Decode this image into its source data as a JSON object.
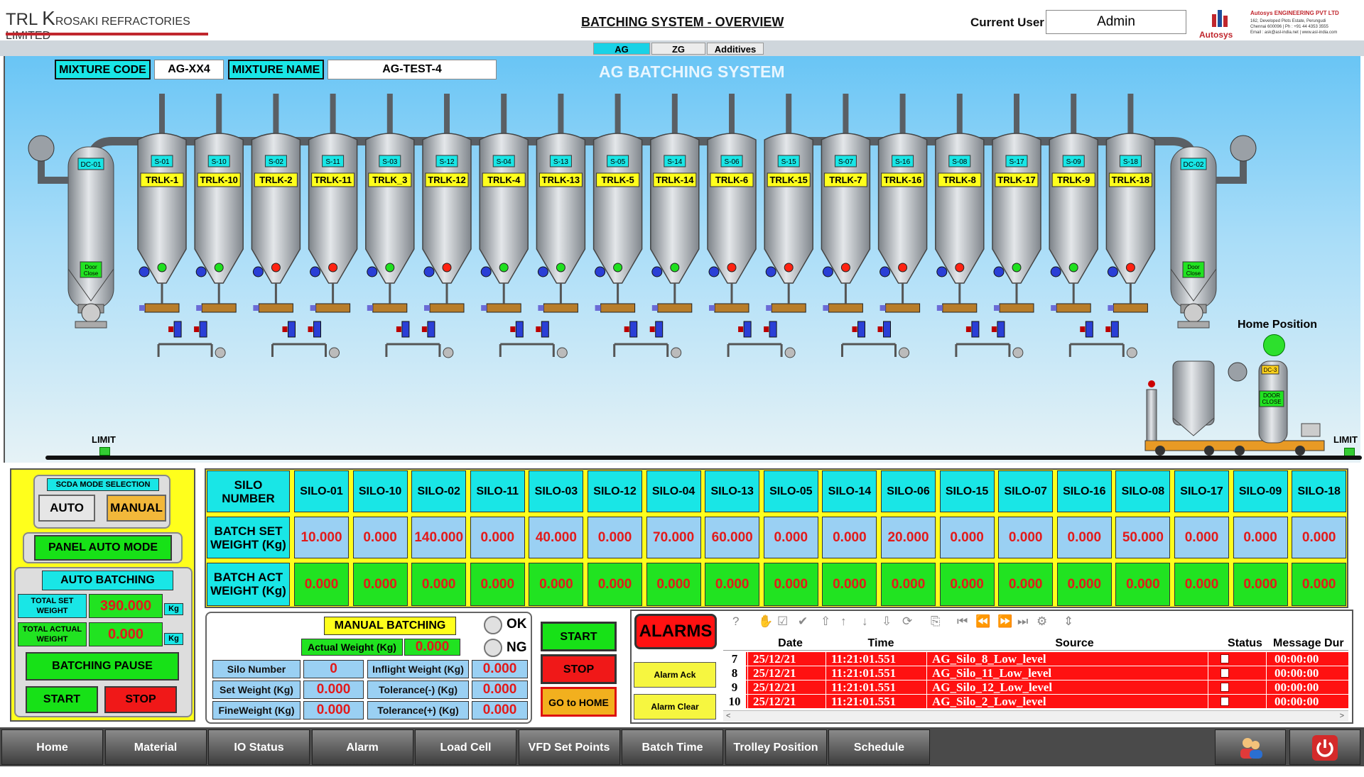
{
  "header": {
    "logo_trl": "TRL",
    "logo_k": "K",
    "logo_rest": "ROSAKI REFRACTORIES LIMITED",
    "title": "BATCHING SYSTEM - OVERVIEW",
    "current_user_label": "Current User",
    "current_user": "Admin",
    "vendor_name": "Autosys ENGINEERING PVT LTD",
    "vendor_address_1": "162, Developed Plots Estate, Perungudi",
    "vendor_address_2": "Chennai 600096 | Ph : +91 44 4353 3555",
    "vendor_address_3": "Email : ask@asl-india.net | www.asl-india.com",
    "vendor_logo": "Autosys"
  },
  "tabs": [
    "AG",
    "ZG",
    "Additives"
  ],
  "active_tab": "AG",
  "plant": {
    "system_name": "AG BATCHING SYSTEM",
    "mixture_code_label": "MIXTURE CODE",
    "mixture_code": "AG-XX4",
    "mixture_name_label": "MIXTURE NAME",
    "mixture_name": "AG-TEST-4",
    "silos": [
      {
        "id": "S-01",
        "trolley": "TRLK-1",
        "status": "green"
      },
      {
        "id": "S-10",
        "trolley": "TRLK-10",
        "status": "green"
      },
      {
        "id": "S-02",
        "trolley": "TRLK-2",
        "status": "red"
      },
      {
        "id": "S-11",
        "trolley": "TRLK-11",
        "status": "red"
      },
      {
        "id": "S-03",
        "trolley": "TRLK_3",
        "status": "green"
      },
      {
        "id": "S-12",
        "trolley": "TRLK-12",
        "status": "red"
      },
      {
        "id": "S-04",
        "trolley": "TRLK-4",
        "status": "green"
      },
      {
        "id": "S-13",
        "trolley": "TRLK-13",
        "status": "green"
      },
      {
        "id": "S-05",
        "trolley": "TRLK-5",
        "status": "green"
      },
      {
        "id": "S-14",
        "trolley": "TRLK-14",
        "status": "green"
      },
      {
        "id": "S-06",
        "trolley": "TRLK-6",
        "status": "red"
      },
      {
        "id": "S-15",
        "trolley": "TRLK-15",
        "status": "red"
      },
      {
        "id": "S-07",
        "trolley": "TRLK-7",
        "status": "red"
      },
      {
        "id": "S-16",
        "trolley": "TRLK-16",
        "status": "red"
      },
      {
        "id": "S-08",
        "trolley": "TRLK-8",
        "status": "red"
      },
      {
        "id": "S-17",
        "trolley": "TRLK-17",
        "status": "green"
      },
      {
        "id": "S-09",
        "trolley": "TRLK-9",
        "status": "green"
      },
      {
        "id": "S-18",
        "trolley": "TRLK-18",
        "status": "red"
      }
    ],
    "dc_left": "DC-01",
    "dc_right": "DC-02",
    "door_label": "Door Close",
    "trolley_dc": "DC-3",
    "trolley_door": "DOOR CLOSE",
    "limit_left": "LIMIT",
    "limit_right": "LIMIT",
    "home_position": "Home Position"
  },
  "mode_panel": {
    "title": "SCDA MODE SELECTION",
    "auto": "AUTO",
    "manual": "MANUAL",
    "panel_auto": "PANEL AUTO MODE",
    "auto_batching": "AUTO BATCHING",
    "total_set_label": "TOTAL  SET WEIGHT",
    "total_set": "390.000",
    "total_actual_label": "TOTAL  ACTUAL WEIGHT",
    "total_actual": "0.000",
    "unit": "Kg",
    "pause": "BATCHING PAUSE",
    "start": "START",
    "stop": "STOP"
  },
  "silo_table": {
    "h_silo": "SILO NUMBER",
    "h_set": "BATCH SET WEIGHT (Kg)",
    "h_act": "BATCH ACT WEIGHT (Kg)",
    "columns": [
      "SILO-01",
      "SILO-10",
      "SILO-02",
      "SILO-11",
      "SILO-03",
      "SILO-12",
      "SILO-04",
      "SILO-13",
      "SILO-05",
      "SILO-14",
      "SILO-06",
      "SILO-15",
      "SILO-07",
      "SILO-16",
      "SILO-08",
      "SILO-17",
      "SILO-09",
      "SILO-18"
    ],
    "set": [
      "10.000",
      "0.000",
      "140.000",
      "0.000",
      "40.000",
      "0.000",
      "70.000",
      "60.000",
      "0.000",
      "0.000",
      "20.000",
      "0.000",
      "0.000",
      "0.000",
      "50.000",
      "0.000",
      "0.000",
      "0.000"
    ],
    "act": [
      "0.000",
      "0.000",
      "0.000",
      "0.000",
      "0.000",
      "0.000",
      "0.000",
      "0.000",
      "0.000",
      "0.000",
      "0.000",
      "0.000",
      "0.000",
      "0.000",
      "0.000",
      "0.000",
      "0.000",
      "0.000"
    ]
  },
  "manual": {
    "title": "MANUAL BATCHING",
    "actual_label": "Actual Weight (Kg)",
    "actual": "0.000",
    "ok": "OK",
    "ng": "NG",
    "silo_no_label": "Silo Number",
    "silo_no": "0",
    "set_label": "Set Weight (Kg)",
    "set": "0.000",
    "fine_label": "FineWeight (Kg)",
    "fine": "0.000",
    "inflight_label": "Inflight Weight (Kg)",
    "inflight": "0.000",
    "tol_minus_label": "Tolerance(-) (Kg)",
    "tol_minus": "0.000",
    "tol_plus_label": "Tolerance(+) (Kg)",
    "tol_plus": "0.000",
    "start": "START",
    "stop": "STOP",
    "home": "GO to HOME"
  },
  "alarms": {
    "title": "ALARMS",
    "ack": "Alarm Ack",
    "clear": "Alarm Clear",
    "columns": [
      "Date",
      "Time",
      "Source",
      "Status",
      "Message Dur"
    ],
    "rows": [
      {
        "n": "7",
        "date": "25/12/21",
        "time": "11:21:01.551",
        "source": "AG_Silo_8_Low_level",
        "dur": "00:00:00"
      },
      {
        "n": "8",
        "date": "25/12/21",
        "time": "11:21:01.551",
        "source": "AG_Silo_11_Low_level",
        "dur": "00:00:00"
      },
      {
        "n": "9",
        "date": "25/12/21",
        "time": "11:21:01.551",
        "source": "AG_Silo_12_Low_level",
        "dur": "00:00:00"
      },
      {
        "n": "10",
        "date": "25/12/21",
        "time": "11:21:01.551",
        "source": "AG_Silo_2_Low_level",
        "dur": "00:00:00"
      }
    ]
  },
  "nav": [
    "Home",
    "Material",
    "IO Status",
    "Alarm",
    "Load Cell",
    "VFD Set Points",
    "Batch Time",
    "Trolley Position",
    "Schedule"
  ],
  "colors": {
    "sky": "#69c5f5",
    "panel_yellow": "#ffff1c",
    "cyan_label": "#19e6e6",
    "ok_green": "#21e321",
    "alarm_red": "#f11"
  }
}
